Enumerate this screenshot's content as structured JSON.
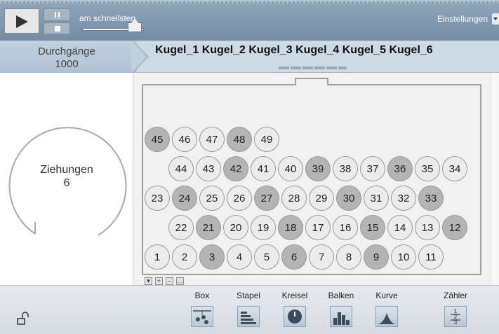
{
  "controls": {
    "speed_label": "am schnellsten",
    "settings_label": "Einstellungen",
    "speed_level": 0.85
  },
  "header": {
    "runs_label": "Durchgänge",
    "runs_value": "1000",
    "ball_names": "Kugel_1 Kugel_2 Kugel_3 Kugel_4 Kugel_5 Kugel_6"
  },
  "draws": {
    "label": "Ziehungen",
    "value": "6"
  },
  "urn": {
    "rows": [
      [
        {
          "n": "45",
          "shade": "dark"
        },
        {
          "n": "46",
          "shade": "light"
        },
        {
          "n": "47",
          "shade": "light"
        },
        {
          "n": "48",
          "shade": "dark"
        },
        {
          "n": "49",
          "shade": "light"
        }
      ],
      [
        {
          "n": "44",
          "shade": "light"
        },
        {
          "n": "43",
          "shade": "light"
        },
        {
          "n": "42",
          "shade": "dark"
        },
        {
          "n": "41",
          "shade": "light"
        },
        {
          "n": "40",
          "shade": "light"
        },
        {
          "n": "39",
          "shade": "dark"
        },
        {
          "n": "38",
          "shade": "light"
        },
        {
          "n": "37",
          "shade": "light"
        },
        {
          "n": "36",
          "shade": "dark"
        },
        {
          "n": "35",
          "shade": "light"
        },
        {
          "n": "34",
          "shade": "light"
        }
      ],
      [
        {
          "n": "23",
          "shade": "light"
        },
        {
          "n": "24",
          "shade": "dark"
        },
        {
          "n": "25",
          "shade": "light"
        },
        {
          "n": "26",
          "shade": "light"
        },
        {
          "n": "27",
          "shade": "dark"
        },
        {
          "n": "28",
          "shade": "light"
        },
        {
          "n": "29",
          "shade": "light"
        },
        {
          "n": "30",
          "shade": "dark"
        },
        {
          "n": "31",
          "shade": "light"
        },
        {
          "n": "32",
          "shade": "light"
        },
        {
          "n": "33",
          "shade": "dark"
        }
      ],
      [
        {
          "n": "22",
          "shade": "light"
        },
        {
          "n": "21",
          "shade": "dark"
        },
        {
          "n": "20",
          "shade": "light"
        },
        {
          "n": "19",
          "shade": "light"
        },
        {
          "n": "18",
          "shade": "dark"
        },
        {
          "n": "17",
          "shade": "light"
        },
        {
          "n": "16",
          "shade": "light"
        },
        {
          "n": "15",
          "shade": "dark"
        },
        {
          "n": "14",
          "shade": "light"
        },
        {
          "n": "13",
          "shade": "light"
        },
        {
          "n": "12",
          "shade": "dark"
        }
      ],
      [
        {
          "n": "1",
          "shade": "light"
        },
        {
          "n": "2",
          "shade": "light"
        },
        {
          "n": "3",
          "shade": "dark"
        },
        {
          "n": "4",
          "shade": "light"
        },
        {
          "n": "5",
          "shade": "light"
        },
        {
          "n": "6",
          "shade": "dark"
        },
        {
          "n": "7",
          "shade": "light"
        },
        {
          "n": "8",
          "shade": "light"
        },
        {
          "n": "9",
          "shade": "dark"
        },
        {
          "n": "10",
          "shade": "light"
        },
        {
          "n": "11",
          "shade": "light"
        }
      ]
    ],
    "zoom_buttons": [
      "▾",
      "+",
      "–",
      "…"
    ]
  },
  "toolbar": {
    "tools": [
      {
        "label": "Box",
        "icon": "box-icon"
      },
      {
        "label": "Stapel",
        "icon": "stack-icon"
      },
      {
        "label": "Kreisel",
        "icon": "spinner-icon"
      },
      {
        "label": "Balken",
        "icon": "bar-chart-icon"
      },
      {
        "label": "Kurve",
        "icon": "curve-icon"
      },
      {
        "label": "Zähler",
        "icon": "counter-icon"
      }
    ],
    "counter_digits": [
      "1",
      "2",
      "3"
    ]
  },
  "colors": {
    "ball_light": "#ececec",
    "ball_dark": "#b4b4b4",
    "topbar": "#7f97ad"
  }
}
